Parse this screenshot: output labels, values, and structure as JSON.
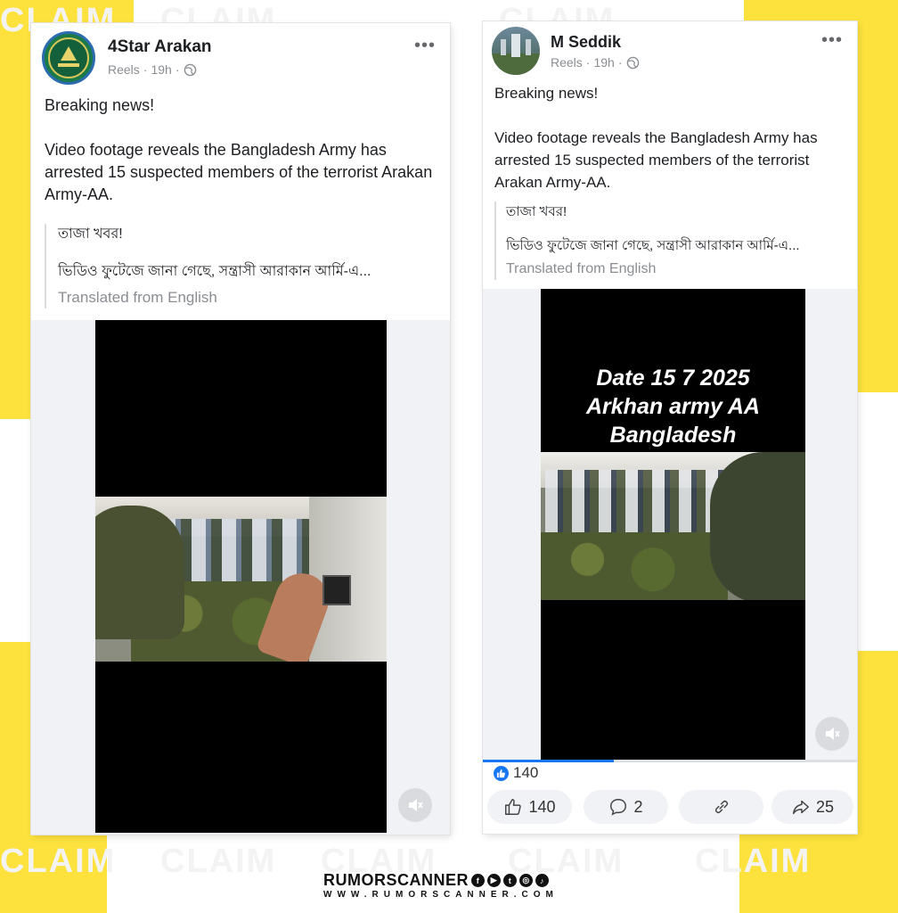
{
  "watermark": {
    "word": "CLAIM"
  },
  "post1": {
    "author": "4Star Arakan",
    "type": "Reels",
    "time": "19h",
    "text_line1": "Breaking news!",
    "text_body": "Video footage reveals the Bangladesh Army has arrested 15 suspected members of the terrorist Arakan Army-AA.",
    "orig_line1": "তাজা খবর!",
    "orig_line2": "ভিডিও ফুটেজে জানা গেছে, সন্ত্রাসী আরাকান আর্মি-এ...",
    "translated": "Translated from English",
    "more_icon": "more-horizontal-icon",
    "globe_icon": "globe-icon",
    "mute_icon": "muted-speaker-icon"
  },
  "post2": {
    "author": "M Seddik",
    "type": "Reels",
    "time": "19h",
    "text_line1": "Breaking news!",
    "text_body": "Video footage reveals the Bangladesh Army has arrested 15 suspected members of the terrorist Arakan Army-AA.",
    "orig_line1": "তাজা খবর!",
    "orig_line2": "ভিডিও ফুটেজে জানা গেছে, সন্ত্রাসী আরাকান আর্মি-এ...",
    "translated": "Translated from English",
    "overlay_line1": "Date 15 7 2025",
    "overlay_line2": "Arkhan army AA",
    "overlay_line3": "Bangladesh",
    "reaction_count": "140",
    "like_count": "140",
    "comment_count": "2",
    "share_count": "25",
    "progress": 0.35,
    "accent": "#1877f2"
  },
  "footer": {
    "brand": "RUMORSCANNER",
    "site": "WWW.RUMORSCANNER.COM",
    "social_icons": [
      "facebook-icon",
      "youtube-icon",
      "twitter-icon",
      "instagram-icon",
      "tiktok-icon"
    ]
  },
  "colors": {
    "accent_yellow": "#fde23d",
    "facebook_blue": "#1877f2"
  }
}
